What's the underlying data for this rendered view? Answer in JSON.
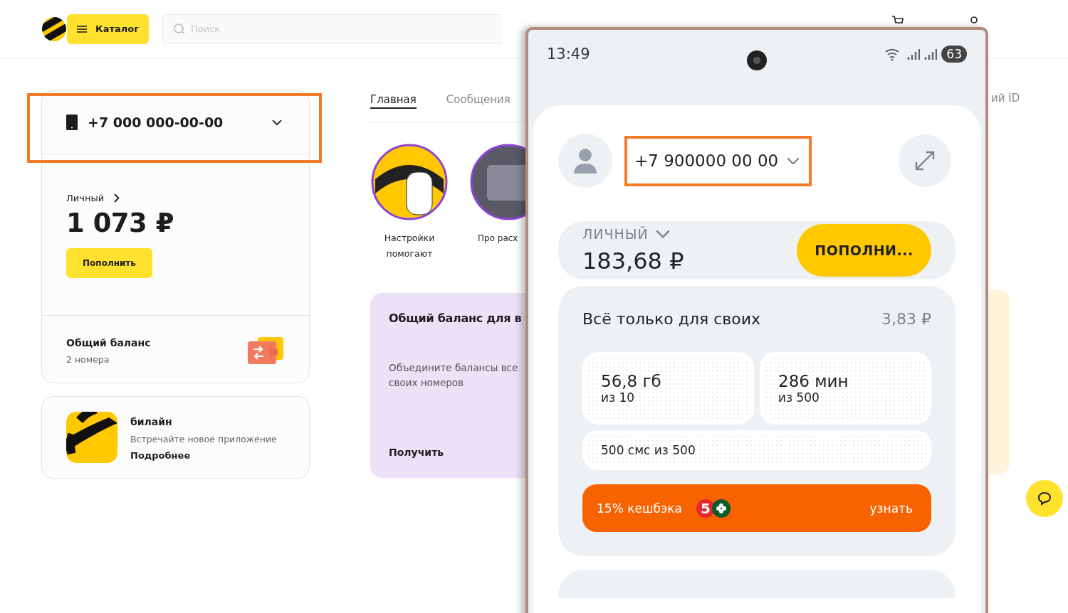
{
  "header": {
    "catalog_button": "Каталог",
    "search": {
      "placeholder": "Поиск"
    }
  },
  "account_card": {
    "phone": "+7 000 000-00-00",
    "highlighted": true,
    "balance_label": "Личный",
    "balance": "1 073 ₽",
    "top_up": "Пополнить",
    "shared_title": "Общий баланс",
    "shared_subtitle": "2 номера"
  },
  "app_card": {
    "title": "билайн",
    "text": "Встречайте новое приложение",
    "link": "Подробнее"
  },
  "tabs": [
    {
      "label": "Главная",
      "selected": true
    },
    {
      "label": "Сообщения",
      "selected": false
    }
  ],
  "right_tab": "ий ID",
  "stories": [
    {
      "caption": "Настройки помогают"
    },
    {
      "caption": "Про расх"
    }
  ],
  "promo": {
    "title": "Общий баланс для в",
    "text_lines": [
      "Объедините балансы все",
      "своих номеров"
    ],
    "action": "Получить"
  },
  "phone": {
    "time": "13:49",
    "battery": "63",
    "number": "+7 900000 00 00",
    "number_highlighted": true,
    "balance_label": "ЛИЧНЫЙ",
    "balance": "183,68 ₽",
    "top_up": "ПОПОЛНИ...",
    "tariff": {
      "title": "Всё только для своих",
      "price": "3,83 ₽",
      "counters": [
        {
          "value": "56,8 гб",
          "subtitle": "из 10"
        },
        {
          "value": "286 мин",
          "subtitle": "из 500"
        }
      ],
      "sms": "500 смс из 500",
      "cashback": {
        "text": "15% кешбэка",
        "badge": "5",
        "link": "узнать"
      }
    }
  }
}
